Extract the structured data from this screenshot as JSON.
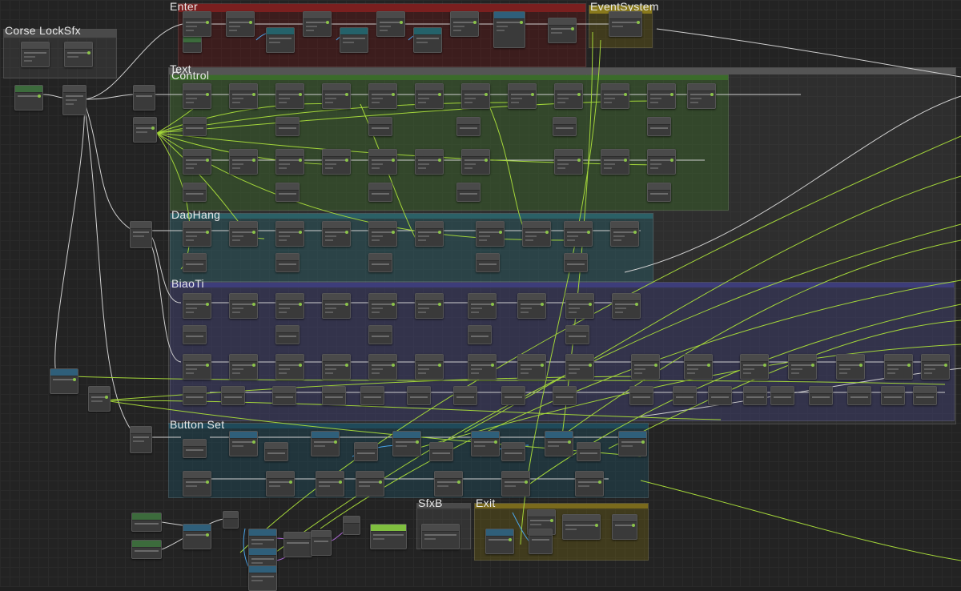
{
  "graph": {
    "groups": [
      {
        "title": "Enter",
        "color": "#7a1f1f"
      },
      {
        "title": "EventSystem",
        "color": "#8a7a1c"
      },
      {
        "title": "Corse LockSfx",
        "color": "#4a4a4a"
      },
      {
        "title": "Text",
        "color": "#555555"
      },
      {
        "title": "Control",
        "color": "#3b6b2a"
      },
      {
        "title": "DaoHang",
        "color": "#2b6066"
      },
      {
        "title": "BiaoTi",
        "color": "#3d3d7a"
      },
      {
        "title": "Button Set",
        "color": "#1f4a5a"
      },
      {
        "title": "SfxB",
        "color": "#4a4a4a"
      },
      {
        "title": "Exit",
        "color": "#7a6a1c"
      }
    ]
  },
  "colors": {
    "background": "#232323",
    "wire_flow": "#cfcfcf",
    "wire_data": "#a4d63a",
    "wire_object": "#4aa3e8",
    "wire_purple": "#b06ad9"
  }
}
